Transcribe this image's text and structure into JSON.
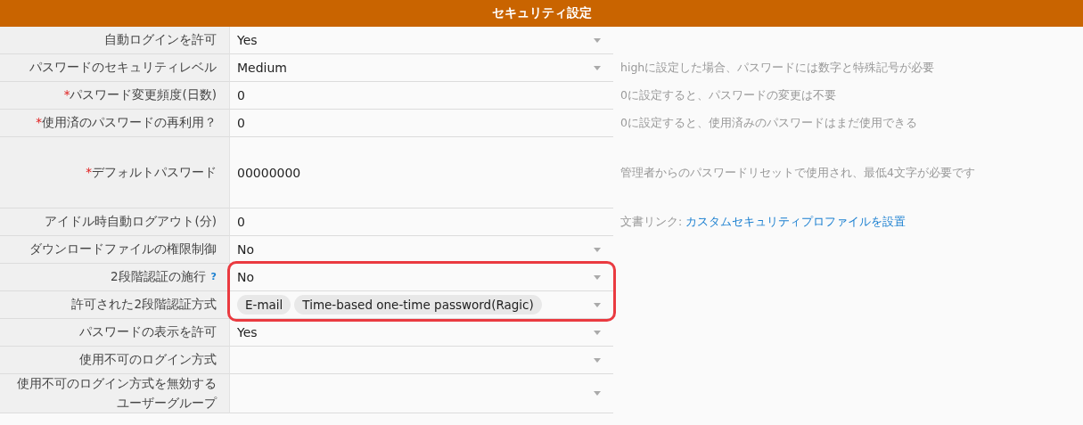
{
  "header": {
    "title": "セキュリティ設定"
  },
  "rows": [
    {
      "label": "自動ログインを許可",
      "kind": "select",
      "value": "Yes",
      "highlighted": false
    },
    {
      "label": "パスワードのセキュリティレベル",
      "kind": "select",
      "value": "Medium",
      "hint": "highに設定した場合、パスワードには数字と特殊記号が必要",
      "highlighted": false
    },
    {
      "label": "パスワード変更頻度(日数)",
      "required_mark": "*",
      "kind": "text",
      "value": "0",
      "hint": "0に設定すると、パスワードの変更は不要",
      "highlighted": false
    },
    {
      "label": "使用済のパスワードの再利用？",
      "required_mark": "*",
      "kind": "text",
      "value": "0",
      "hint": "0に設定すると、使用済みのパスワードはまだ使用できる",
      "highlighted": false
    },
    {
      "label": "デフォルトパスワード",
      "required_mark": "*",
      "kind": "textarea",
      "value": "00000000",
      "hint": "管理者からのパスワードリセットで使用され、最低4文字が必要です",
      "highlighted": false
    },
    {
      "label": "アイドル時自動ログアウト(分)",
      "kind": "text",
      "value": "0",
      "hint": "文書リンク: ",
      "hint_link": "カスタムセキュリティプロファイルを設置",
      "highlighted": false
    },
    {
      "label": "ダウンロードファイルの権限制御",
      "kind": "select",
      "value": "No",
      "highlighted": false
    },
    {
      "label": "2段階認証の施行",
      "help": "?",
      "kind": "select",
      "value": "No",
      "highlighted": true
    },
    {
      "label": "許可された2段階認証方式",
      "kind": "multiselect",
      "tags": [
        "E-mail",
        "Time-based one-time password(Ragic)"
      ],
      "highlighted": true
    },
    {
      "label": "パスワードの表示を許可",
      "kind": "select",
      "value": "Yes",
      "highlighted": false
    },
    {
      "label": "使用不可のログイン方式",
      "kind": "select",
      "value": "",
      "highlighted": false
    },
    {
      "label": "使用不可のログイン方式を無効するユーザーグループ",
      "kind": "select",
      "value": "",
      "highlighted": false
    }
  ]
}
